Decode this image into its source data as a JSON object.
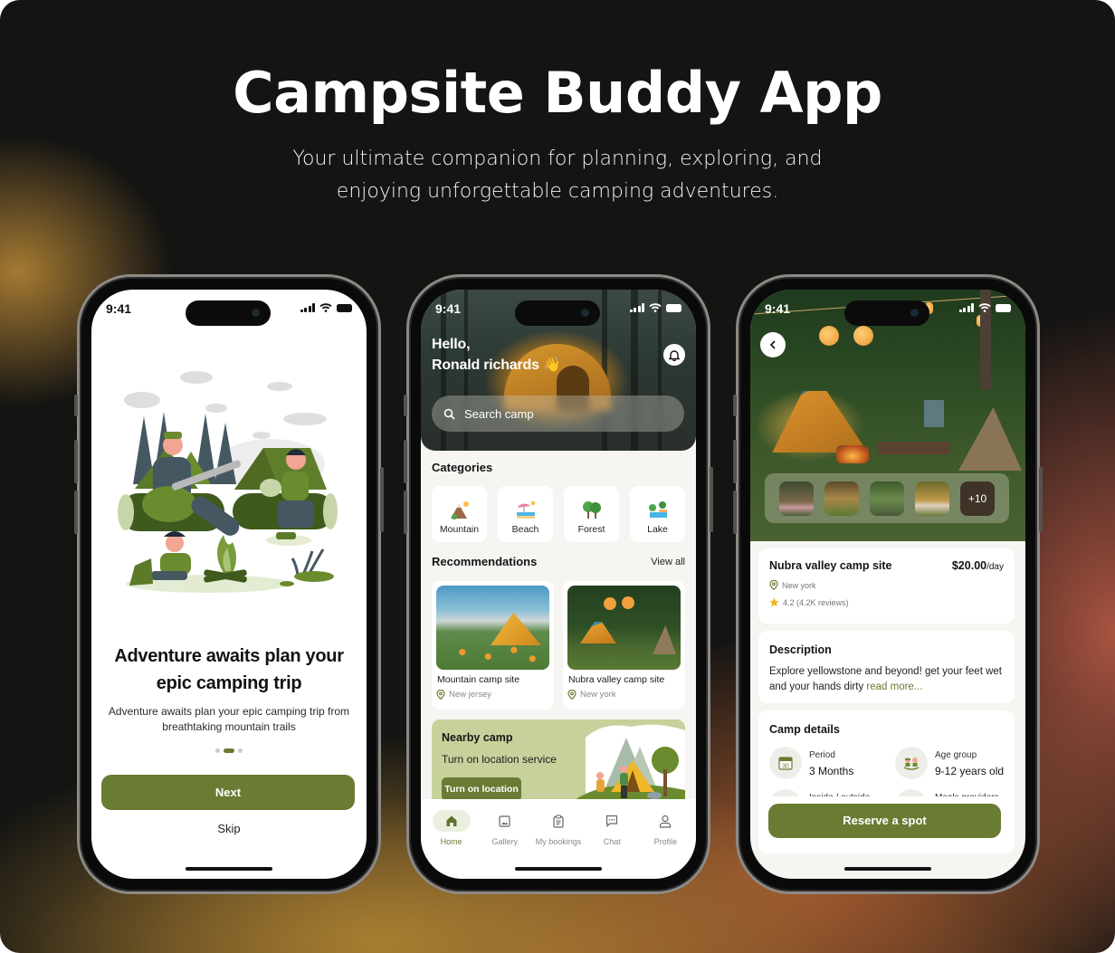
{
  "header": {
    "title": "Campsite Buddy App",
    "subtitle_lines": [
      "Your ultimate companion for planning, exploring, and",
      "enjoying unforgettable camping adventures."
    ]
  },
  "colors": {
    "brand": "#6a7b33",
    "brand_light": "#c7d19b",
    "background": "#141413"
  },
  "status_bar": {
    "time": "9:41"
  },
  "onboarding": {
    "title_lines": [
      "Adventure awaits plan your",
      "epic camping trip"
    ],
    "description_lines": [
      "Adventure awaits plan your epic camping trip from",
      "breathtaking mountain trails"
    ],
    "pager": {
      "total": 3,
      "active_index": 1
    },
    "next_label": "Next",
    "skip_label": "Skip"
  },
  "home": {
    "greeting_line1": "Hello,",
    "greeting_line2": "Ronald richards 👋",
    "search_placeholder": "Search camp",
    "categories_title": "Categories",
    "categories": [
      {
        "label": "Mountain",
        "icon": "mountain-icon"
      },
      {
        "label": "Beach",
        "icon": "beach-icon"
      },
      {
        "label": "Forest",
        "icon": "forest-icon"
      },
      {
        "label": "Lake",
        "icon": "lake-icon"
      }
    ],
    "recommendations_title": "Recommendations",
    "view_all_label": "View all",
    "recommendations": [
      {
        "name": "Mountain camp site",
        "location": "New jersey"
      },
      {
        "name": "Nubra valley camp site",
        "location": "New york"
      }
    ],
    "nearby": {
      "title": "Nearby camp",
      "subtitle": "Turn on location service",
      "button_label": "Turn on location"
    },
    "tabs": [
      {
        "label": "Home",
        "icon": "home-icon",
        "active": true
      },
      {
        "label": "Gallery",
        "icon": "gallery-icon",
        "active": false
      },
      {
        "label": "My bookings",
        "icon": "clipboard-icon",
        "active": false
      },
      {
        "label": "Chat",
        "icon": "chat-icon",
        "active": false
      },
      {
        "label": "Profile",
        "icon": "profile-icon",
        "active": false
      }
    ]
  },
  "detail": {
    "gallery_more_label": "+10",
    "name": "Nubra valley camp site",
    "price": "$20.00",
    "price_unit": "/day",
    "location": "New york",
    "rating": "4.2 (4.2K reviews)",
    "description_title": "Description",
    "description_text": "Explore yellowstone and beyond! get your feet wet and your hands dirty ",
    "read_more_label": "read more...",
    "camp_details_title": "Camp details",
    "details": [
      {
        "label": "Period",
        "value": "3 Months",
        "icon": "calendar-icon",
        "calendar_day": "30"
      },
      {
        "label": "Age group",
        "value": "9-12 years old",
        "icon": "kids-icon"
      },
      {
        "label": "Inside / outside",
        "value": "",
        "icon": "tent-icon"
      },
      {
        "label": "Meals providers",
        "value": "",
        "icon": "meal-icon"
      }
    ],
    "reserve_label": "Reserve a spot"
  }
}
